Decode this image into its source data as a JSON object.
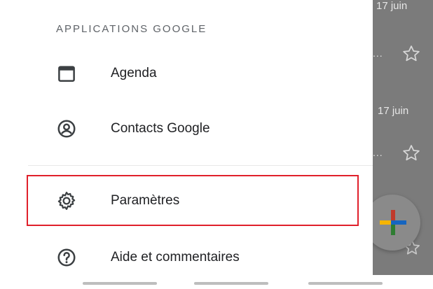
{
  "drawer": {
    "section_header": "APPLICATIONS GOOGLE",
    "items": [
      {
        "label": "Agenda",
        "icon": "calendar-icon"
      },
      {
        "label": "Contacts Google",
        "icon": "contacts-icon"
      },
      {
        "label": "Paramètres",
        "icon": "gear-icon"
      },
      {
        "label": "Aide et commentaires",
        "icon": "help-icon"
      }
    ],
    "highlighted_item": "Paramètres",
    "highlight_color": "#e0202b"
  },
  "background": {
    "dates": [
      "17 juin",
      "17 juin"
    ],
    "ellipsis": "...",
    "star_icon": "star-outline-icon",
    "fab_icon": "compose-plus-icon"
  },
  "colors": {
    "text": "#202124",
    "header": "#5f6368",
    "icon": "#3c4043",
    "scrim": "#7b7b7b"
  }
}
